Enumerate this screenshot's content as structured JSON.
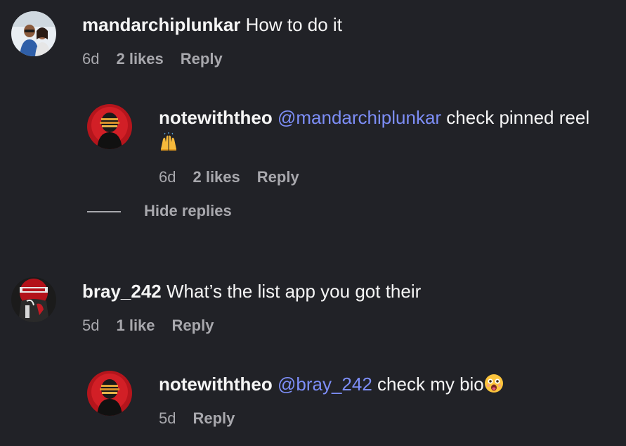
{
  "comments": [
    {
      "username": "mandarchiplunkar",
      "text": "How to do it",
      "time": "6d",
      "likes": "2 likes",
      "reply_label": "Reply",
      "replies": [
        {
          "username": "notewiththeo",
          "mention": "@mandarchiplunkar",
          "text": "check pinned reel",
          "emoji": "raised-hands-emoji",
          "time": "6d",
          "likes": "2 likes",
          "reply_label": "Reply"
        }
      ],
      "hide_replies_label": "Hide replies"
    },
    {
      "username": "bray_242",
      "text": "What’s the list app you got their",
      "time": "5d",
      "likes": "1 like",
      "reply_label": "Reply",
      "replies": [
        {
          "username": "notewiththeo",
          "mention": "@bray_242",
          "text": "check my bio",
          "emoji": "astonished-face-emoji",
          "time": "5d",
          "reply_label": "Reply"
        }
      ]
    }
  ],
  "colors": {
    "background": "#212227",
    "text": "#f5f5f5",
    "muted": "#a8a8ad",
    "mention": "#7d8ef7"
  }
}
